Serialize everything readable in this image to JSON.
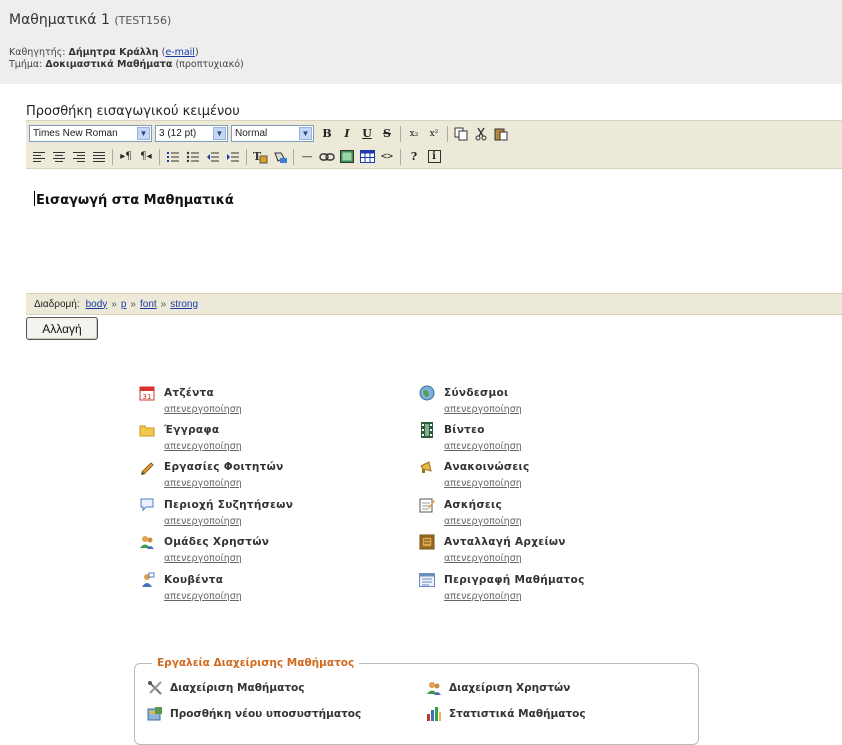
{
  "header": {
    "course_title": "Μαθηματικά 1",
    "course_code": "(TEST156)",
    "teacher_label": "Καθηγητής:",
    "teacher_name": "Δήμητρα Κράλλη",
    "email_open": " (",
    "email_link": "e-mail",
    "email_close": ")",
    "department_label": "Τμήμα:",
    "department_name": "Δοκιμαστικά Μαθήματα",
    "department_type": "(προπτυχιακό)"
  },
  "editor": {
    "section_title": "Προσθήκη εισαγωγικού κειμένου",
    "font_family": "Times New Roman",
    "font_size": "3 (12 pt)",
    "format": "Normal",
    "content": "Εισαγωγή στα Μαθηματικά",
    "path_label": "Διαδρομή:",
    "path": [
      "body",
      "p",
      "font",
      "strong"
    ],
    "path_separator": "»",
    "change_button": "Αλλαγή"
  },
  "toolbar_glyphs": {
    "bold": "B",
    "italic": "I",
    "underline": "U",
    "strike": "S",
    "subscript": "x₂",
    "superscript": "x²",
    "help": "?",
    "info": "i",
    "source": "<>",
    "hr": "—"
  },
  "tools": {
    "deactivate_label": "απενεργοποίηση",
    "left": [
      {
        "label": "Ατζέντα",
        "icon": "calendar-icon"
      },
      {
        "label": "Έγγραφα",
        "icon": "folder-icon"
      },
      {
        "label": "Εργασίες Φοιτητών",
        "icon": "pencil-icon"
      },
      {
        "label": "Περιοχή Συζητήσεων",
        "icon": "speech-bubble-icon"
      },
      {
        "label": "Ομάδες Χρηστών",
        "icon": "users-icon"
      },
      {
        "label": "Κουβέντα",
        "icon": "chat-icon"
      }
    ],
    "right": [
      {
        "label": "Σύνδεσμοι",
        "icon": "globe-icon"
      },
      {
        "label": "Βίντεο",
        "icon": "film-icon"
      },
      {
        "label": "Ανακοινώσεις",
        "icon": "megaphone-icon"
      },
      {
        "label": "Ασκήσεις",
        "icon": "notepad-icon"
      },
      {
        "label": "Ανταλλαγή Αρχείων",
        "icon": "file-exchange-icon"
      },
      {
        "label": "Περιγραφή Μαθήματος",
        "icon": "document-list-icon"
      }
    ]
  },
  "admin": {
    "legend": "Εργαλεία Διαχείρισης Μαθήματος",
    "items": [
      {
        "label": "Διαχείριση Μαθήματος",
        "icon": "tools-icon"
      },
      {
        "label": "Διαχείριση Χρηστών",
        "icon": "users-admin-icon"
      },
      {
        "label": "Προσθήκη νέου υποσυστήματος",
        "icon": "add-module-icon"
      },
      {
        "label": "Στατιστικά Μαθήματος",
        "icon": "bar-chart-icon"
      }
    ]
  }
}
